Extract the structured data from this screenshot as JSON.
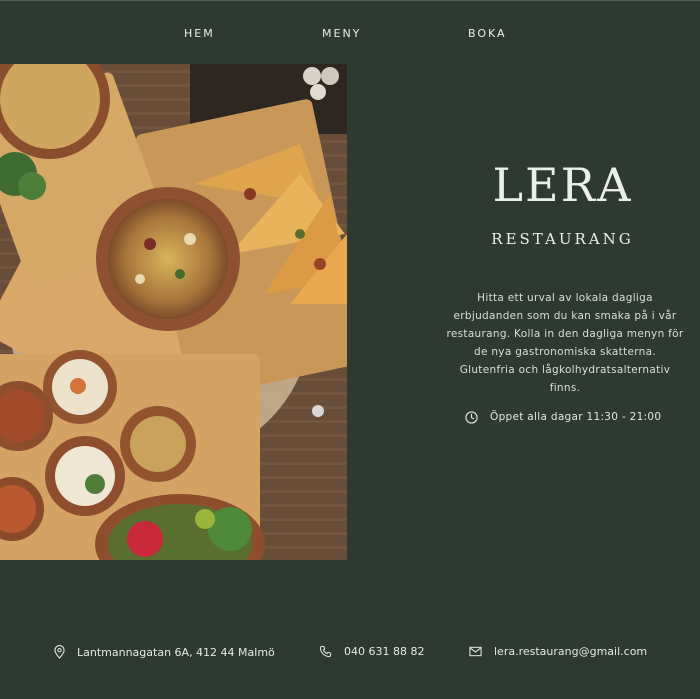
{
  "nav": {
    "items": [
      {
        "label": "HEM"
      },
      {
        "label": "MENY"
      },
      {
        "label": "BOKA"
      }
    ]
  },
  "hero": {
    "icon": "food-photo"
  },
  "brand": {
    "title": "LERA",
    "subtitle": "RESTAURANG"
  },
  "description": "Hitta ett urval av lokala dagliga erbjudanden som du kan smaka på i vår restaurang. Kolla in den dagliga menyn för de nya gastronomiska skatterna. Glutenfria och lågkolhydratsalternativ finns.",
  "hours": {
    "icon": "clock-icon",
    "text": "Öppet alla dagar 11:30 - 21:00"
  },
  "footer": {
    "address": {
      "icon": "location-pin-icon",
      "text": "Lantmannagatan 6A, 412 44 Malmö"
    },
    "phone": {
      "icon": "phone-icon",
      "text": "040 631 88 82"
    },
    "email": {
      "icon": "mail-icon",
      "text": "lera.restaurang@gmail.com"
    }
  },
  "colors": {
    "background": "#2e3a31",
    "text": "#e6e9e4"
  }
}
